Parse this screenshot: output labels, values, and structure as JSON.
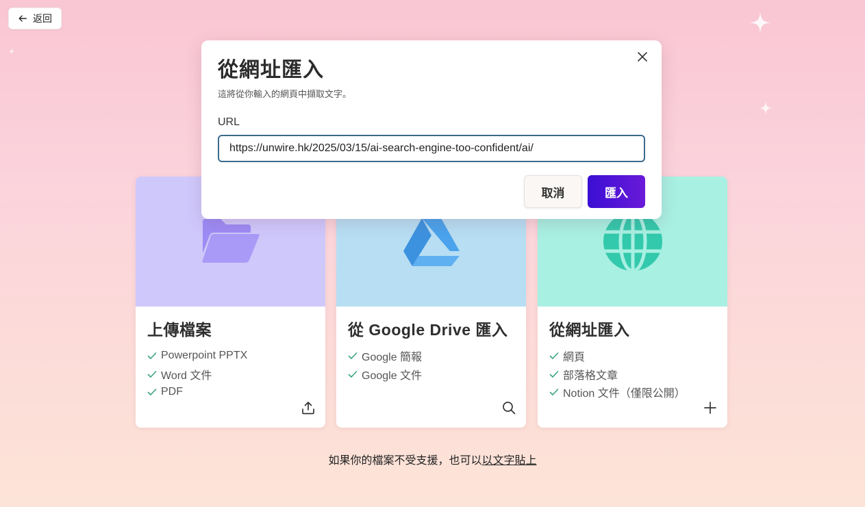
{
  "back_button": {
    "label": "返回",
    "icon": "arrow-left-icon"
  },
  "cards": {
    "upload": {
      "title": "上傳檔案",
      "features": [
        "Powerpoint PPTX",
        "Word 文件",
        "PDF"
      ],
      "icon": "folder-icon",
      "action_icon": "upload-icon"
    },
    "drive": {
      "title": "從 Google Drive 匯入",
      "features": [
        "Google 簡報",
        "Google 文件"
      ],
      "icon": "google-drive-icon",
      "action_icon": "search-icon"
    },
    "url": {
      "title": "從網址匯入",
      "features": [
        "網頁",
        "部落格文章",
        "Notion 文件（僅限公開）"
      ],
      "icon": "globe-icon",
      "action_icon": "plus-icon"
    }
  },
  "footer": {
    "text": "如果你的檔案不受支援，也可以",
    "link": "以文字貼上"
  },
  "modal": {
    "title": "從網址匯入",
    "subtitle": "這將從你輸入的網頁中擷取文字。",
    "url_label": "URL",
    "url_value": "https://unwire.hk/2025/03/15/ai-search-engine-too-confident/ai/",
    "cancel_label": "取消",
    "import_label": "匯入",
    "close_icon": "close-icon"
  },
  "colors": {
    "accent": "#3a0fd4",
    "check": "#3aa37e",
    "upload_banner": "#cfc8fb",
    "drive_banner": "#b7def3",
    "url_banner": "#a8f0e2"
  }
}
